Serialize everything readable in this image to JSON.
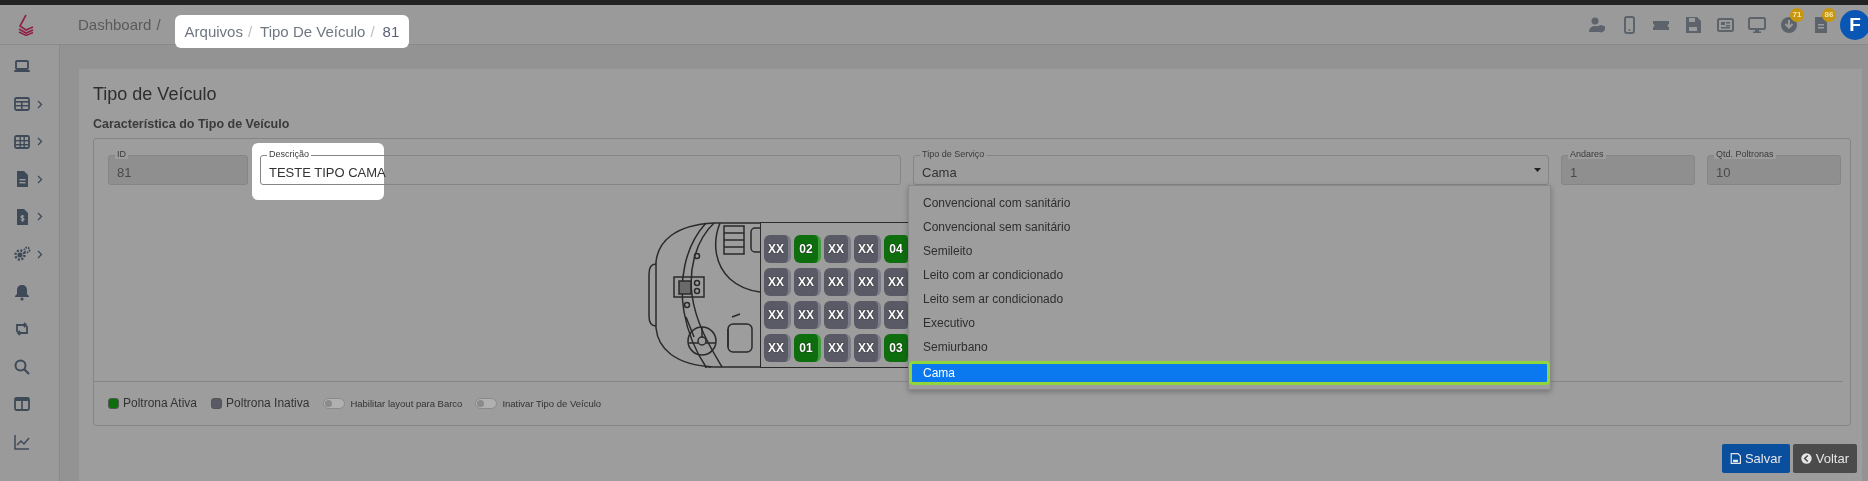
{
  "header": {
    "breadcrumb": [
      {
        "label": "Dashboard",
        "highlighted": false
      },
      {
        "label": "Arquivos",
        "highlighted": true
      },
      {
        "label": "Tipo De Veículo",
        "highlighted": true
      },
      {
        "label": "81",
        "highlighted": true
      }
    ],
    "separator": "/",
    "toolbar": [
      {
        "kind": "plain"
      },
      {
        "kind": "plain"
      },
      {
        "kind": "plain"
      },
      {
        "kind": "plain"
      },
      {
        "kind": "plain"
      },
      {
        "kind": "plain"
      },
      {
        "kind": "badged",
        "badge": "71"
      },
      {
        "kind": "badged",
        "badge": "86"
      }
    ],
    "avatar": "F"
  },
  "sidebar": {
    "items": [
      {
        "has_submenu": false
      },
      {
        "has_submenu": true
      },
      {
        "has_submenu": true
      },
      {
        "has_submenu": true
      },
      {
        "has_submenu": true
      },
      {
        "has_submenu": true
      },
      {
        "has_submenu": false
      },
      {
        "has_submenu": false
      },
      {
        "has_submenu": false
      },
      {
        "has_submenu": false
      },
      {
        "has_submenu": false
      }
    ]
  },
  "page": {
    "title": "Tipo de Veículo",
    "section": "Característica do Tipo de Veículo"
  },
  "fields": [
    {
      "kind": "text",
      "label": "ID",
      "value": "81",
      "disabled": true,
      "highlighted": false
    },
    {
      "kind": "text",
      "label": "Descrição",
      "value": "TESTE TIPO CAMA",
      "disabled": false,
      "highlighted": true
    },
    {
      "kind": "select",
      "label": "Tipo de Serviço",
      "value": "Cama",
      "disabled": false,
      "highlighted": false,
      "expanded": true,
      "options": [
        {
          "label": "Convencional com sanitário",
          "selected": false
        },
        {
          "label": "Convencional sem sanitário",
          "selected": false
        },
        {
          "label": "Semileito",
          "selected": false
        },
        {
          "label": "Leito com ar condicionado",
          "selected": false
        },
        {
          "label": "Leito sem ar condicionado",
          "selected": false
        },
        {
          "label": "Executivo",
          "selected": false
        },
        {
          "label": "Semiurbano",
          "selected": false
        },
        {
          "label": "Cama",
          "selected": true
        }
      ]
    },
    {
      "kind": "text",
      "label": "Andares",
      "value": "1",
      "disabled": true,
      "highlighted": false
    },
    {
      "kind": "text",
      "label": "Qtd. Poltronas",
      "value": "10",
      "disabled": true,
      "highlighted": false
    }
  ],
  "seats": [
    [
      {
        "label": "XX",
        "active": false
      },
      {
        "label": "02",
        "active": true
      },
      {
        "label": "XX",
        "active": false
      },
      {
        "label": "XX",
        "active": false
      },
      {
        "label": "04",
        "active": true
      }
    ],
    [
      {
        "label": "XX",
        "active": false
      },
      {
        "label": "XX",
        "active": false
      },
      {
        "label": "XX",
        "active": false
      },
      {
        "label": "XX",
        "active": false
      },
      {
        "label": "XX",
        "active": false
      }
    ],
    [
      {
        "label": "XX",
        "active": false
      },
      {
        "label": "XX",
        "active": false
      },
      {
        "label": "XX",
        "active": false
      },
      {
        "label": "XX",
        "active": false
      },
      {
        "label": "XX",
        "active": false
      }
    ],
    [
      {
        "label": "XX",
        "active": false
      },
      {
        "label": "01",
        "active": true
      },
      {
        "label": "XX",
        "active": false
      },
      {
        "label": "XX",
        "active": false
      },
      {
        "label": "03",
        "active": true
      }
    ]
  ],
  "legend": [
    {
      "label": "Poltrona Ativa",
      "color": "#0e6e0e"
    },
    {
      "label": "Poltrona Inativa",
      "color": "#5a5a66"
    }
  ],
  "toggles": [
    {
      "label": "Habilitar layout para Barco",
      "on": false
    },
    {
      "label": "Inativar Tipo de Veículo",
      "on": false
    }
  ],
  "buttons": [
    {
      "kind": "primary",
      "label": "Salvar"
    },
    {
      "kind": "secondary",
      "label": "Voltar"
    }
  ]
}
